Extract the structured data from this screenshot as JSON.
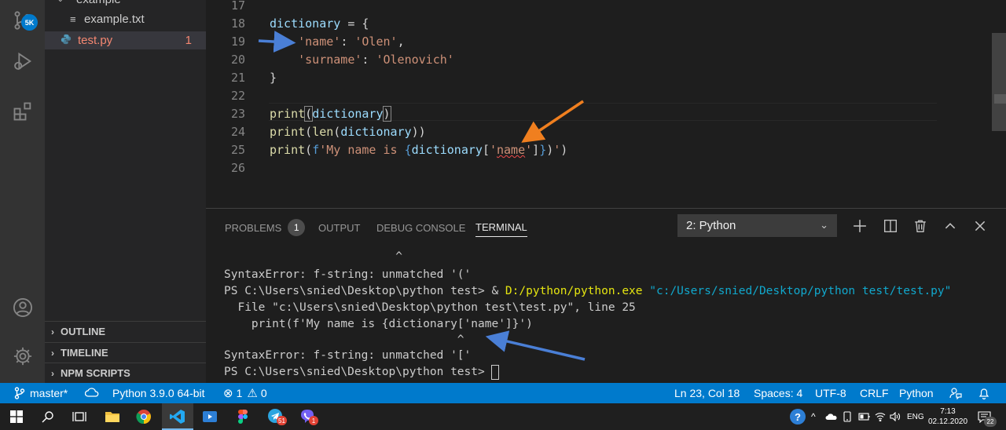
{
  "activity_bar": {
    "source_control_badge": "5K"
  },
  "explorer": {
    "folder_label": "example",
    "files": [
      {
        "name": "example.txt",
        "errors": ""
      },
      {
        "name": "test.py",
        "errors": "1"
      }
    ],
    "sections": [
      "OUTLINE",
      "TIMELINE",
      "NPM SCRIPTS"
    ]
  },
  "editor": {
    "lines": [
      {
        "number": "17",
        "text": ""
      },
      {
        "number": "18",
        "text": "dictionary = {"
      },
      {
        "number": "19",
        "text": "    'name': 'Olen',"
      },
      {
        "number": "20",
        "text": "    'surname': 'Olenovich'"
      },
      {
        "number": "21",
        "text": "}"
      },
      {
        "number": "22",
        "text": ""
      },
      {
        "number": "23",
        "text": "print(dictionary)"
      },
      {
        "number": "24",
        "text": "print(len(dictionary))"
      },
      {
        "number": "25",
        "text": "print(f'My name is {dictionary['name']}')"
      },
      {
        "number": "26",
        "text": ""
      }
    ]
  },
  "panel": {
    "tabs": [
      "PROBLEMS",
      "OUTPUT",
      "DEBUG CONSOLE",
      "TERMINAL"
    ],
    "problems_count": "1",
    "active_tab": "TERMINAL",
    "terminal_selector": "2: Python",
    "terminal_lines": [
      "                         ^",
      "SyntaxError: f-string: unmatched '('",
      "PS C:\\Users\\snied\\Desktop\\python test> & ",
      "  File \"c:\\Users\\snied\\Desktop\\python test\\test.py\", line 25",
      "    print(f'My name is {dictionary['name']}')",
      "                                  ^",
      "SyntaxError: f-string: unmatched '['",
      "PS C:\\Users\\snied\\Desktop\\python test> "
    ],
    "command_exe": "D:/python/python.exe",
    "command_arg": "\"c:/Users/snied/Desktop/python test/test.py\""
  },
  "status_bar": {
    "branch": "master*",
    "interpreter": "Python 3.9.0 64-bit",
    "errors": "1",
    "warnings": "0",
    "position": "Ln 23, Col 18",
    "indent": "Spaces: 4",
    "encoding": "UTF-8",
    "eol": "CRLF",
    "language": "Python"
  },
  "taskbar": {
    "language": "ENG",
    "time": "7:13",
    "date": "02.12.2020",
    "notification_count": "22",
    "telegram_badge": "51",
    "viber_badge": "1"
  },
  "colors": {
    "accent": "#007acc",
    "annotation_blue": "#4a7fd6",
    "annotation_orange": "#f07f1f",
    "error": "#f14c4c"
  }
}
